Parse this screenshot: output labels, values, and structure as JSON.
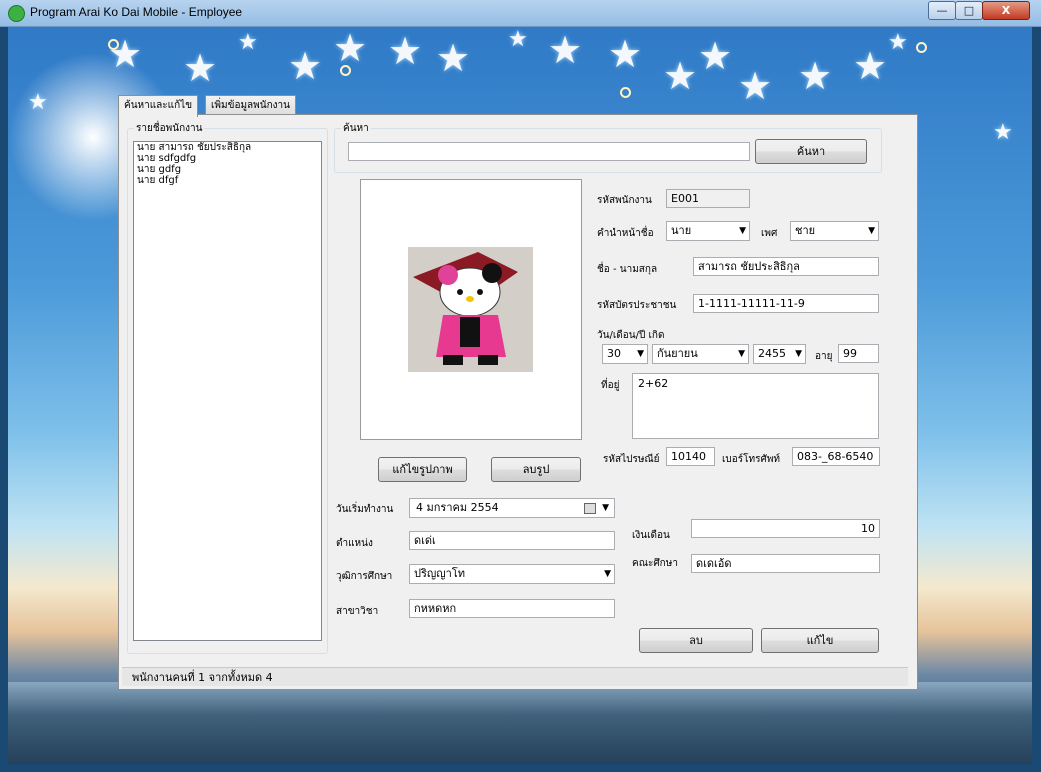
{
  "window": {
    "title": "Program Arai Ko Dai Mobile - Employee",
    "min": "—",
    "max": "□",
    "close": "X"
  },
  "tabs": [
    {
      "label": "ค้นหาและแก้ไข"
    },
    {
      "label": "เพิ่มข้อมูลพนักงาน"
    }
  ],
  "employee_list": {
    "legend": "รายชื่อพนักงาน",
    "items": [
      "นาย สามารถ ชัยประสิธิกุล",
      "นาย sdfgdfg",
      "นาย gdfg",
      "นาย dfgf"
    ]
  },
  "search": {
    "legend": "ค้นหา",
    "value": "",
    "button": "ค้นหา"
  },
  "photo": {
    "edit_button": "แก้ไขรูปภาพ",
    "delete_button": "ลบรูป",
    "image_icon": "hello-kitty-photo"
  },
  "form": {
    "emp_id_label": "รหัสพนักงาน",
    "emp_id": "E001",
    "prefix_label": "คำนำหน้าชื่อ",
    "prefix": "นาย",
    "gender_label": "เพศ",
    "gender": "ชาย",
    "name_label": "ชื่อ - นามสกุล",
    "name": "สามารถ ชัยประสิธิกุล",
    "citizen_label": "รหัสบัตรประชาชน",
    "citizen": "1-1111-11111-11-9",
    "dob_label": "วัน/เดือน/ปี เกิด",
    "dob_day": "30",
    "dob_month": "กันยายน",
    "dob_year": "2455",
    "age_label": "อายุ",
    "age": "99",
    "address_label": "ที่อยู่",
    "address": "2+62",
    "postal_label": "รหัสไปรษณีย์",
    "postal": "10140",
    "phone_label": "เบอร์โทรศัพท์",
    "phone": "083-_68-6540",
    "start_label": "วันเริ่มทำงาน",
    "start_date": "4   มกราคม    2554",
    "position_label": "ตำแหน่ง",
    "position": "ดเด่เ",
    "salary_label": "เงินเดือน",
    "salary": "10",
    "education_label": "วุฒิการศึกษา",
    "education": "ปริญญาโท",
    "faculty_label": "คณะศึกษา",
    "faculty": "ดเดเอ้ด",
    "major_label": "สาขาวิชา",
    "major": "กหหดหก"
  },
  "actions": {
    "delete": "ลบ",
    "edit": "แก้ไข"
  },
  "status": {
    "text": "พนักงานคนที่  1 จากทั้งหมด 4"
  }
}
